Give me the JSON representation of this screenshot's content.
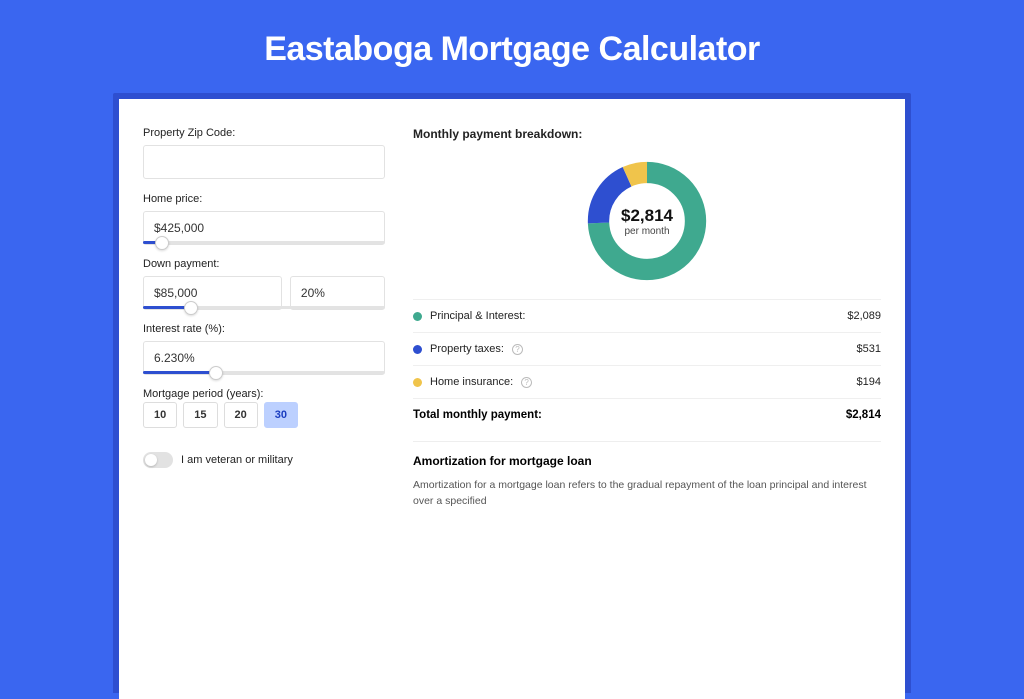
{
  "page": {
    "title": "Eastaboga Mortgage Calculator"
  },
  "form": {
    "zip_label": "Property Zip Code:",
    "zip_value": "",
    "home_price_label": "Home price:",
    "home_price_value": "$425,000",
    "home_price_slider_pct": 8,
    "dp_label": "Down payment:",
    "dp_amount_value": "$85,000",
    "dp_pct_value": "20%",
    "dp_slider_pct": 20,
    "rate_label": "Interest rate (%):",
    "rate_value": "6.230%",
    "rate_slider_pct": 30,
    "period_label": "Mortgage period (years):",
    "periods": [
      "10",
      "15",
      "20",
      "30"
    ],
    "period_active": "30",
    "vet_label": "I am veteran or military"
  },
  "breakdown": {
    "title": "Monthly payment breakdown:",
    "amount": "$2,814",
    "sub": "per month",
    "items": [
      {
        "label": "Principal & Interest:",
        "value": "$2,089",
        "color": "#3fa98f",
        "help": false
      },
      {
        "label": "Property taxes:",
        "value": "$531",
        "color": "#2e4fd0",
        "help": true
      },
      {
        "label": "Home insurance:",
        "value": "$194",
        "color": "#f0c44b",
        "help": true
      }
    ],
    "total_label": "Total monthly payment:",
    "total_value": "$2,814"
  },
  "amort": {
    "title": "Amortization for mortgage loan",
    "body": "Amortization for a mortgage loan refers to the gradual repayment of the loan principal and interest over a specified"
  },
  "chart_data": {
    "type": "pie",
    "title": "Monthly payment breakdown",
    "series": [
      {
        "name": "Principal & Interest",
        "value": 2089,
        "color": "#3fa98f"
      },
      {
        "name": "Property taxes",
        "value": 531,
        "color": "#2e4fd0"
      },
      {
        "name": "Home insurance",
        "value": 194,
        "color": "#f0c44b"
      }
    ],
    "total": 2814,
    "center_label": "$2,814 per month"
  }
}
